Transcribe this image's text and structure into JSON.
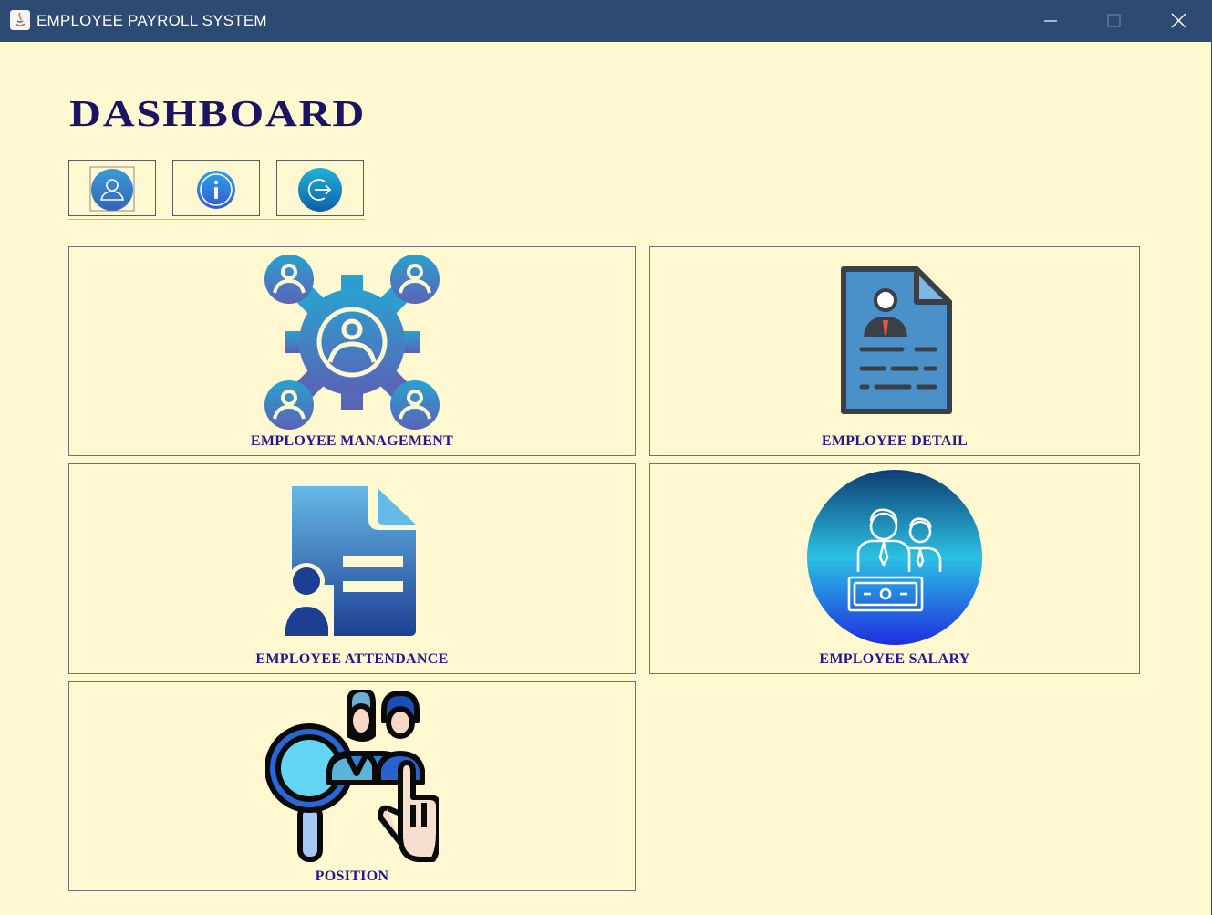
{
  "window": {
    "title": "EMPLOYEE PAYROLL SYSTEM",
    "controls": [
      "minimize-icon",
      "maximize-icon",
      "close-icon"
    ]
  },
  "dashboard": {
    "heading": "DASHBOARD"
  },
  "toolbar": {
    "buttons": [
      {
        "icon": "user-profile-icon"
      },
      {
        "icon": "info-icon"
      },
      {
        "icon": "logout-icon"
      }
    ]
  },
  "modules": [
    {
      "label": "EMPLOYEE MANAGEMENT",
      "icon": "team-gear-icon"
    },
    {
      "label": "EMPLOYEE DETAIL",
      "icon": "resume-document-icon"
    },
    {
      "label": "EMPLOYEE ATTENDANCE",
      "icon": "attendance-document-icon"
    },
    {
      "label": "EMPLOYEE SALARY",
      "icon": "salary-employees-icon"
    },
    {
      "label": "POSITION",
      "icon": "position-search-icon"
    }
  ],
  "colors": {
    "titlebar": "#2c4a72",
    "background": "#fff8d0",
    "heading": "#1b1460",
    "label": "#24178f"
  }
}
